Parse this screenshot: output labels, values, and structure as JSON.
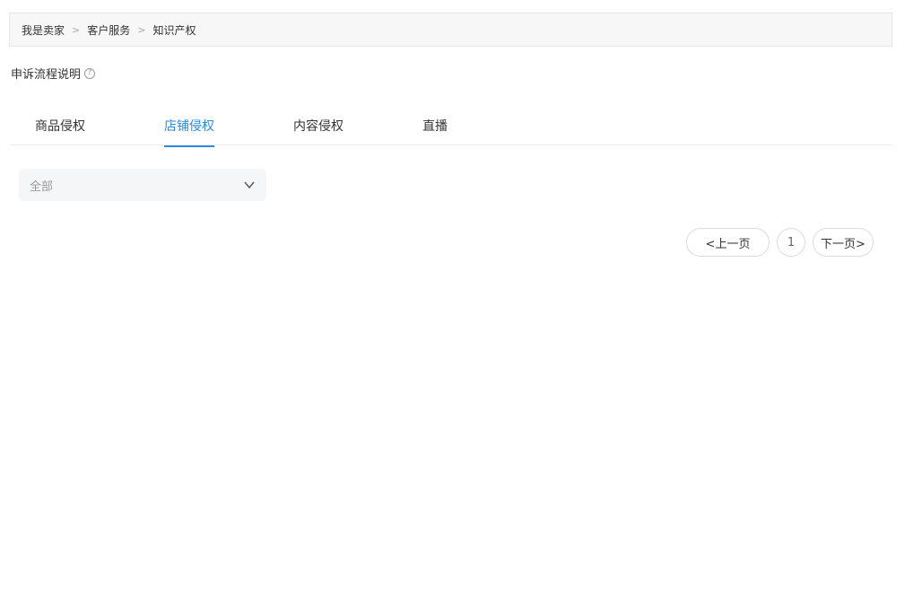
{
  "breadcrumb": {
    "items": [
      "我是卖家",
      "客户服务",
      "知识产权"
    ],
    "separator": ">"
  },
  "help": {
    "label": "申诉流程说明",
    "icon": "?"
  },
  "tabs": [
    {
      "label": "商品侵权",
      "active": false
    },
    {
      "label": "店铺侵权",
      "active": true
    },
    {
      "label": "内容侵权",
      "active": false
    },
    {
      "label": "直播",
      "active": false
    }
  ],
  "filter": {
    "value": "全部"
  },
  "pagination": {
    "prev": "<上一页",
    "page": "1",
    "next": "下一页>"
  },
  "colors": {
    "accent": "#2b8ae5"
  }
}
